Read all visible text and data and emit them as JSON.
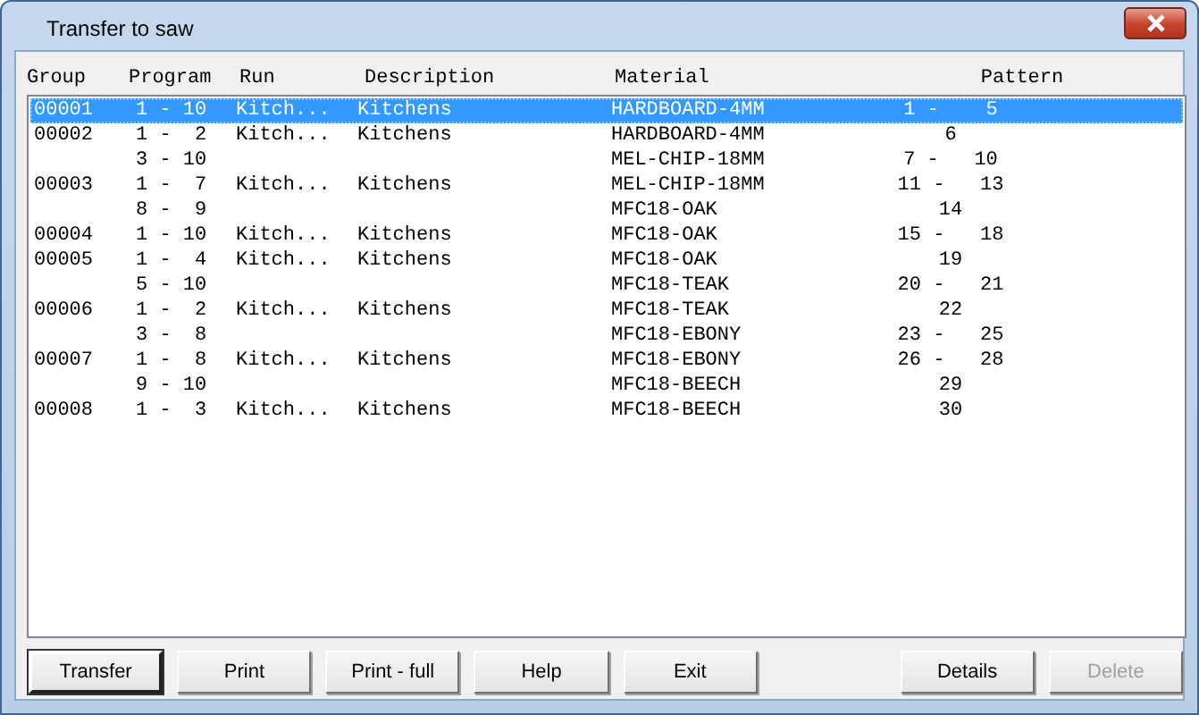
{
  "window": {
    "title": "Transfer to saw"
  },
  "table": {
    "columns": [
      "Group",
      "Program",
      "Run",
      "Description",
      "Material",
      "Pattern"
    ],
    "rows": [
      {
        "group": "00001",
        "program": "1 - 10",
        "run": "Kitch...",
        "description": "Kitchens",
        "material": "HARDBOARD-4MM",
        "pattern": "1 -    5",
        "selected": true
      },
      {
        "group": "00002",
        "program": "1 -  2",
        "run": "Kitch...",
        "description": "Kitchens",
        "material": "HARDBOARD-4MM",
        "pattern": "6",
        "selected": false
      },
      {
        "program": "3 - 10",
        "material": "MEL-CHIP-18MM",
        "pattern": "7 -   10",
        "selected": false
      },
      {
        "group": "00003",
        "program": "1 -  7",
        "run": "Kitch...",
        "description": "Kitchens",
        "material": "MEL-CHIP-18MM",
        "pattern": "11 -   13",
        "selected": false
      },
      {
        "program": "8 -  9",
        "material": "MFC18-OAK",
        "pattern": "14",
        "selected": false
      },
      {
        "group": "00004",
        "program": "1 - 10",
        "run": "Kitch...",
        "description": "Kitchens",
        "material": "MFC18-OAK",
        "pattern": "15 -   18",
        "selected": false
      },
      {
        "group": "00005",
        "program": "1 -  4",
        "run": "Kitch...",
        "description": "Kitchens",
        "material": "MFC18-OAK",
        "pattern": "19",
        "selected": false
      },
      {
        "program": "5 - 10",
        "material": "MFC18-TEAK",
        "pattern": "20 -   21",
        "selected": false
      },
      {
        "group": "00006",
        "program": "1 -  2",
        "run": "Kitch...",
        "description": "Kitchens",
        "material": "MFC18-TEAK",
        "pattern": "22",
        "selected": false
      },
      {
        "program": "3 -  8",
        "material": "MFC18-EBONY",
        "pattern": "23 -   25",
        "selected": false
      },
      {
        "group": "00007",
        "program": "1 -  8",
        "run": "Kitch...",
        "description": "Kitchens",
        "material": "MFC18-EBONY",
        "pattern": "26 -   28",
        "selected": false
      },
      {
        "program": "9 - 10",
        "material": "MFC18-BEECH",
        "pattern": "29",
        "selected": false
      },
      {
        "group": "00008",
        "program": "1 -  3",
        "run": "Kitch...",
        "description": "Kitchens",
        "material": "MFC18-BEECH",
        "pattern": "30",
        "selected": false
      }
    ]
  },
  "buttons": [
    {
      "label": "Transfer",
      "default": true,
      "disabled": false
    },
    {
      "label": "Print",
      "default": false,
      "disabled": false
    },
    {
      "label": "Print - full",
      "default": false,
      "disabled": false
    },
    {
      "label": "Help",
      "default": false,
      "disabled": false
    },
    {
      "label": "Exit",
      "default": false,
      "disabled": false
    },
    {
      "label": "Details",
      "default": false,
      "disabled": false
    },
    {
      "label": "Delete",
      "default": false,
      "disabled": true
    }
  ]
}
